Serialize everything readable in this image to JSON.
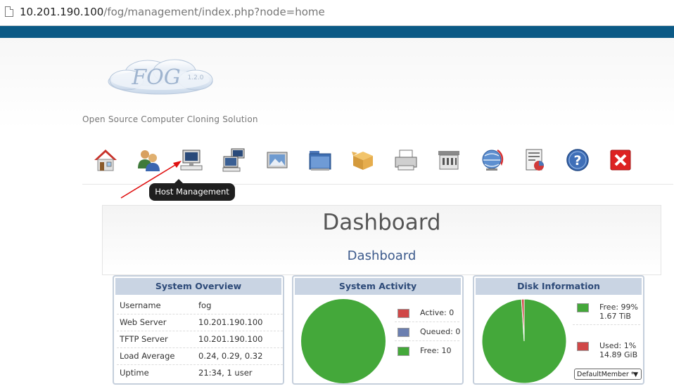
{
  "browser": {
    "url_host": "10.201.190.100",
    "url_path": "/fog/management/index.php?node=home"
  },
  "logo": {
    "text": "FOG",
    "version": "1.2.0"
  },
  "tagline": "Open Source Computer Cloning Solution",
  "nav": {
    "items": [
      {
        "name": "home-icon"
      },
      {
        "name": "users-icon"
      },
      {
        "name": "host-management-icon"
      },
      {
        "name": "group-management-icon"
      },
      {
        "name": "image-management-icon"
      },
      {
        "name": "storage-management-icon"
      },
      {
        "name": "snapin-management-icon"
      },
      {
        "name": "printer-management-icon"
      },
      {
        "name": "service-configuration-icon"
      },
      {
        "name": "task-management-icon"
      },
      {
        "name": "reports-icon"
      },
      {
        "name": "help-icon"
      },
      {
        "name": "logout-icon"
      }
    ],
    "tooltip": "Host Management"
  },
  "dashboard": {
    "title": "Dashboard",
    "subtitle": "Dashboard"
  },
  "system_overview": {
    "title": "System Overview",
    "rows": [
      {
        "key": "Username",
        "value": "fog"
      },
      {
        "key": "Web Server",
        "value": "10.201.190.100"
      },
      {
        "key": "TFTP Server",
        "value": "10.201.190.100"
      },
      {
        "key": "Load Average",
        "value": "0.24, 0.29, 0.32"
      },
      {
        "key": "Uptime",
        "value": "21:34, 1 user"
      }
    ]
  },
  "system_activity": {
    "title": "System Activity",
    "legend": [
      {
        "label": "Active: 0",
        "color": "#d04848"
      },
      {
        "label": "Queued: 0",
        "color": "#6b7fb0"
      },
      {
        "label": "Free: 10",
        "color": "#44a83a"
      }
    ]
  },
  "disk_information": {
    "title": "Disk Information",
    "legend": [
      {
        "line1": "Free: 99%",
        "line2": "1.67 TiB",
        "color": "#44a83a"
      },
      {
        "line1": "Used: 1%",
        "line2": "14.89 GiB",
        "color": "#d04848"
      }
    ],
    "node_select": "DefaultMember *"
  },
  "colors": {
    "accent_bar": "#0b5a86",
    "panel_title_bg": "#c9d4e3",
    "panel_title_text": "#2d4a78",
    "pie_green": "#44a83a",
    "annotation_arrow": "#e01010"
  },
  "chart_data": [
    {
      "type": "pie",
      "categories": [
        "Active",
        "Queued",
        "Free"
      ],
      "values": [
        0,
        0,
        10
      ],
      "title": "System Activity"
    },
    {
      "type": "pie",
      "categories": [
        "Free",
        "Used"
      ],
      "values": [
        99,
        1
      ],
      "title": "Disk Information"
    }
  ]
}
